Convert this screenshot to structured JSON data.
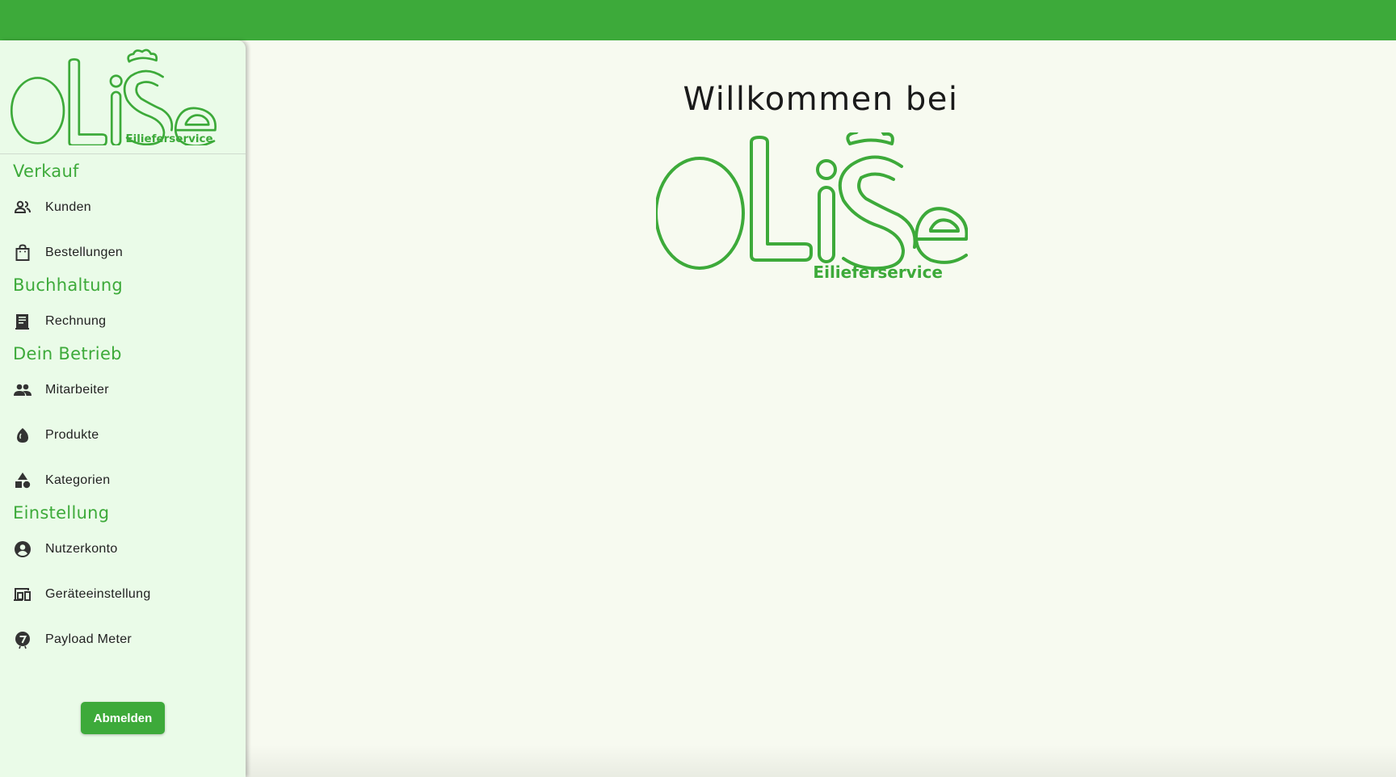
{
  "logo": {
    "text": "OLiSe",
    "subtitle": "Eilieferservice"
  },
  "main": {
    "welcome": "Willkommen bei"
  },
  "sidebar": {
    "sections": [
      {
        "title": "Verkauf"
      },
      {
        "title": "Buchhaltung"
      },
      {
        "title": "Dein Betrieb"
      },
      {
        "title": "Einstellung"
      }
    ],
    "items": [
      {
        "label": "Kunden",
        "icon": "customers-icon"
      },
      {
        "label": "Bestellungen",
        "icon": "shopping-bag-icon"
      },
      {
        "label": "Rechnung",
        "icon": "receipt-icon"
      },
      {
        "label": "Mitarbeiter",
        "icon": "people-icon"
      },
      {
        "label": "Produkte",
        "icon": "egg-icon"
      },
      {
        "label": "Kategorien",
        "icon": "category-shapes-icon"
      },
      {
        "label": "Nutzerkonto",
        "icon": "account-circle-icon"
      },
      {
        "label": "Geräteeinstellung",
        "icon": "devices-icon"
      },
      {
        "label": "Payload Meter",
        "icon": "payload-meter-icon"
      }
    ],
    "logout_label": "Abmelden"
  },
  "colors": {
    "brand": "#3daa3a",
    "sidebar_bg": "#eafbe8",
    "page_bg": "#f7faf0"
  }
}
